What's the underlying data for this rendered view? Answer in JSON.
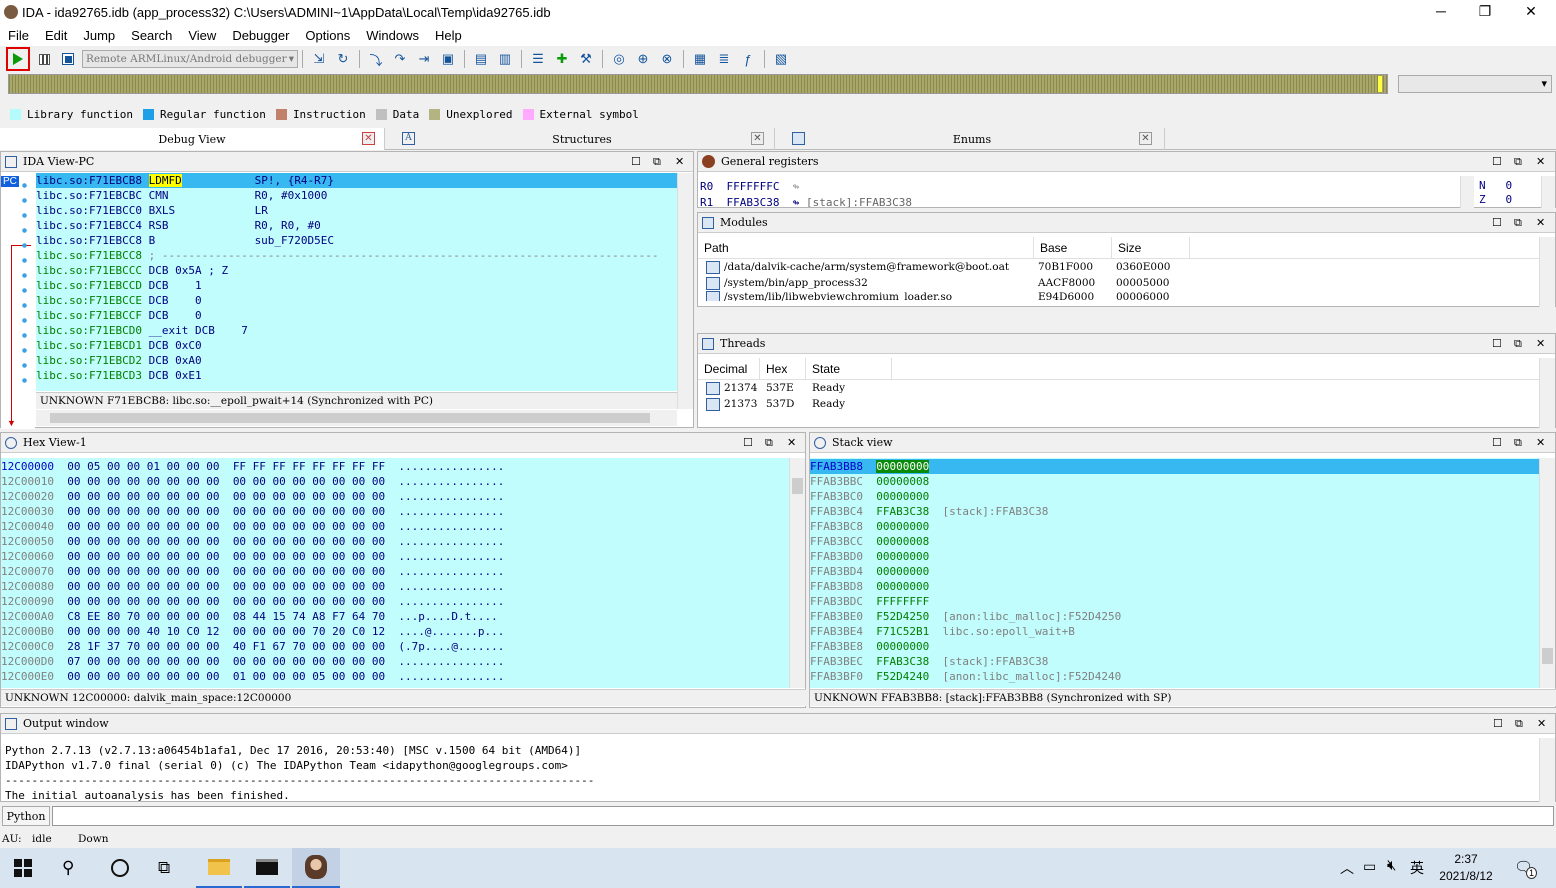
{
  "title": "IDA - ida92765.idb (app_process32) C:\\Users\\ADMINI~1\\AppData\\Local\\Temp\\ida92765.idb",
  "menu": [
    "File",
    "Edit",
    "Jump",
    "Search",
    "View",
    "Debugger",
    "Options",
    "Windows",
    "Help"
  ],
  "debugger_select": "Remote ARMLinux/Android debugger",
  "legend": [
    {
      "label": "Library function",
      "color": "#b4fbfb"
    },
    {
      "label": "Regular function",
      "color": "#1ea0e6"
    },
    {
      "label": "Instruction",
      "color": "#c0806a"
    },
    {
      "label": "Data",
      "color": "#c0c0c0"
    },
    {
      "label": "Unexplored",
      "color": "#b4b482"
    },
    {
      "label": "External symbol",
      "color": "#ffaaff"
    }
  ],
  "tabs": [
    "Debug View",
    "Structures",
    "Enums"
  ],
  "ida_view": {
    "title": "IDA View-PC",
    "pc_label": "PC",
    "lines": [
      {
        "addr": "libc.so:F71EBCB8",
        "mn": "LDMFD",
        "ops": "SP!, {R4-R7}"
      },
      {
        "addr": "libc.so:F71EBCBC",
        "mn": "CMN",
        "ops": "R0, #0x1000"
      },
      {
        "addr": "libc.so:F71EBCC0",
        "mn": "BXLS",
        "ops": "LR"
      },
      {
        "addr": "libc.so:F71EBCC4",
        "mn": "RSB",
        "ops": "R0, R0, #0"
      },
      {
        "addr": "libc.so:F71EBCC8",
        "mn": "B",
        "ops": "sub_F720D5EC"
      },
      {
        "addr": "libc.so:F71EBCC8",
        "mn": "; ---------------------------------------------------------------------------",
        "ops": ""
      },
      {
        "addr": "libc.so:F71EBCCC",
        "mn": "DCB 0x5A ; Z",
        "ops": ""
      },
      {
        "addr": "libc.so:F71EBCCD",
        "mn": "DCB    1",
        "ops": ""
      },
      {
        "addr": "libc.so:F71EBCCE",
        "mn": "DCB    0",
        "ops": ""
      },
      {
        "addr": "libc.so:F71EBCCF",
        "mn": "DCB    0",
        "ops": ""
      },
      {
        "addr": "libc.so:F71EBCD0",
        "mn": "__exit DCB    7",
        "ops": ""
      },
      {
        "addr": "libc.so:F71EBCD1",
        "mn": "DCB 0xC0",
        "ops": ""
      },
      {
        "addr": "libc.so:F71EBCD2",
        "mn": "DCB 0xA0",
        "ops": ""
      },
      {
        "addr": "libc.so:F71EBCD3",
        "mn": "DCB 0xE1",
        "ops": ""
      }
    ],
    "status": "UNKNOWN F71EBCB8: libc.so:__epoll_pwait+14 (Synchronized with PC)"
  },
  "registers": {
    "title": "General registers",
    "rows": [
      {
        "name": "R0",
        "value": "FFFFFFFC",
        "note": ""
      },
      {
        "name": "R1",
        "value": "FFAB3C38",
        "note": "[stack]:FFAB3C38"
      }
    ],
    "flags": [
      {
        "name": "N",
        "value": "0"
      },
      {
        "name": "Z",
        "value": "0"
      }
    ]
  },
  "modules": {
    "title": "Modules",
    "headers": [
      "Path",
      "Base",
      "Size"
    ],
    "rows": [
      {
        "path": "/data/dalvik-cache/arm/system@framework@boot.oat",
        "base": "70B1F000",
        "size": "0360E000"
      },
      {
        "path": "/system/bin/app_process32",
        "base": "AACF8000",
        "size": "00005000"
      },
      {
        "path": "/system/lib/libwebviewchromium_loader.so",
        "base": "E94D6000",
        "size": "00006000"
      }
    ]
  },
  "threads": {
    "title": "Threads",
    "headers": [
      "Decimal",
      "Hex",
      "State"
    ],
    "rows": [
      {
        "dec": "21374",
        "hex": "537E",
        "state": "Ready"
      },
      {
        "dec": "21373",
        "hex": "537D",
        "state": "Ready"
      }
    ]
  },
  "hex_view": {
    "title": "Hex View-1",
    "rows": [
      {
        "addr": "12C00000",
        "b1": "00 05 00 00 01 00 00 00",
        "b2": "FF FF FF FF FF FF FF FF",
        "asc": "................"
      },
      {
        "addr": "12C00010",
        "b1": "00 00 00 00 00 00 00 00",
        "b2": "00 00 00 00 00 00 00 00",
        "asc": "................"
      },
      {
        "addr": "12C00020",
        "b1": "00 00 00 00 00 00 00 00",
        "b2": "00 00 00 00 00 00 00 00",
        "asc": "................"
      },
      {
        "addr": "12C00030",
        "b1": "00 00 00 00 00 00 00 00",
        "b2": "00 00 00 00 00 00 00 00",
        "asc": "................"
      },
      {
        "addr": "12C00040",
        "b1": "00 00 00 00 00 00 00 00",
        "b2": "00 00 00 00 00 00 00 00",
        "asc": "................"
      },
      {
        "addr": "12C00050",
        "b1": "00 00 00 00 00 00 00 00",
        "b2": "00 00 00 00 00 00 00 00",
        "asc": "................"
      },
      {
        "addr": "12C00060",
        "b1": "00 00 00 00 00 00 00 00",
        "b2": "00 00 00 00 00 00 00 00",
        "asc": "................"
      },
      {
        "addr": "12C00070",
        "b1": "00 00 00 00 00 00 00 00",
        "b2": "00 00 00 00 00 00 00 00",
        "asc": "................"
      },
      {
        "addr": "12C00080",
        "b1": "00 00 00 00 00 00 00 00",
        "b2": "00 00 00 00 00 00 00 00",
        "asc": "................"
      },
      {
        "addr": "12C00090",
        "b1": "00 00 00 00 00 00 00 00",
        "b2": "00 00 00 00 00 00 00 00",
        "asc": "................"
      },
      {
        "addr": "12C000A0",
        "b1": "C8 EE 80 70 00 00 00 00",
        "b2": "08 44 15 74 A8 F7 64 70",
        "asc": "...p....D.t...."
      },
      {
        "addr": "12C000B0",
        "b1": "00 00 00 00 40 10 C0 12",
        "b2": "00 00 00 00 70 20 C0 12",
        "asc": "....@.......p..."
      },
      {
        "addr": "12C000C0",
        "b1": "28 1F 37 70 00 00 00 00",
        "b2": "40 F1 67 70 00 00 00 00",
        "asc": "(.7p....@......."
      },
      {
        "addr": "12C000D0",
        "b1": "07 00 00 00 00 00 00 00",
        "b2": "00 00 00 00 00 00 00 00",
        "asc": "................"
      },
      {
        "addr": "12C000E0",
        "b1": "00 00 00 00 00 00 00 00",
        "b2": "01 00 00 00 05 00 00 00",
        "asc": "................"
      }
    ],
    "status": "UNKNOWN 12C00000: dalvik_main_space:12C00000"
  },
  "stack_view": {
    "title": "Stack view",
    "rows": [
      {
        "addr": "FFAB3BB8",
        "val": "00000000",
        "note": ""
      },
      {
        "addr": "FFAB3BBC",
        "val": "00000008",
        "note": ""
      },
      {
        "addr": "FFAB3BC0",
        "val": "00000000",
        "note": ""
      },
      {
        "addr": "FFAB3BC4",
        "val": "FFAB3C38",
        "note": "[stack]:FFAB3C38"
      },
      {
        "addr": "FFAB3BC8",
        "val": "00000000",
        "note": ""
      },
      {
        "addr": "FFAB3BCC",
        "val": "00000008",
        "note": ""
      },
      {
        "addr": "FFAB3BD0",
        "val": "00000000",
        "note": ""
      },
      {
        "addr": "FFAB3BD4",
        "val": "00000000",
        "note": ""
      },
      {
        "addr": "FFAB3BD8",
        "val": "00000000",
        "note": ""
      },
      {
        "addr": "FFAB3BDC",
        "val": "FFFFFFFF",
        "note": ""
      },
      {
        "addr": "FFAB3BE0",
        "val": "F52D4250",
        "note": "[anon:libc_malloc]:F52D4250"
      },
      {
        "addr": "FFAB3BE4",
        "val": "F71C52B1",
        "note": "libc.so:epoll_wait+B"
      },
      {
        "addr": "FFAB3BE8",
        "val": "00000000",
        "note": ""
      },
      {
        "addr": "FFAB3BEC",
        "val": "FFAB3C38",
        "note": "[stack]:FFAB3C38"
      },
      {
        "addr": "FFAB3BF0",
        "val": "F52D4240",
        "note": "[anon:libc_malloc]:F52D4240"
      }
    ],
    "status": "UNKNOWN FFAB3BB8: [stack]:FFAB3BB8 (Synchronized with SP)"
  },
  "output": {
    "title": "Output window",
    "lines": [
      "Python 2.7.13 (v2.7.13:a06454b1afa1, Dec 17 2016, 20:53:40) [MSC v.1500 64 bit (AMD64)]",
      "IDAPython v1.7.0 final (serial 0) (c) The IDAPython Team <idapython@googlegroups.com>",
      "-----------------------------------------------------------------------------------------",
      "The initial autoanalysis has been finished."
    ],
    "lang_button": "Python"
  },
  "statusbar": {
    "au": "AU:",
    "state": "idle",
    "dir": "Down"
  },
  "taskbar": {
    "ime": "英",
    "time": "2:37",
    "date": "2021/8/12",
    "notif": "1"
  }
}
